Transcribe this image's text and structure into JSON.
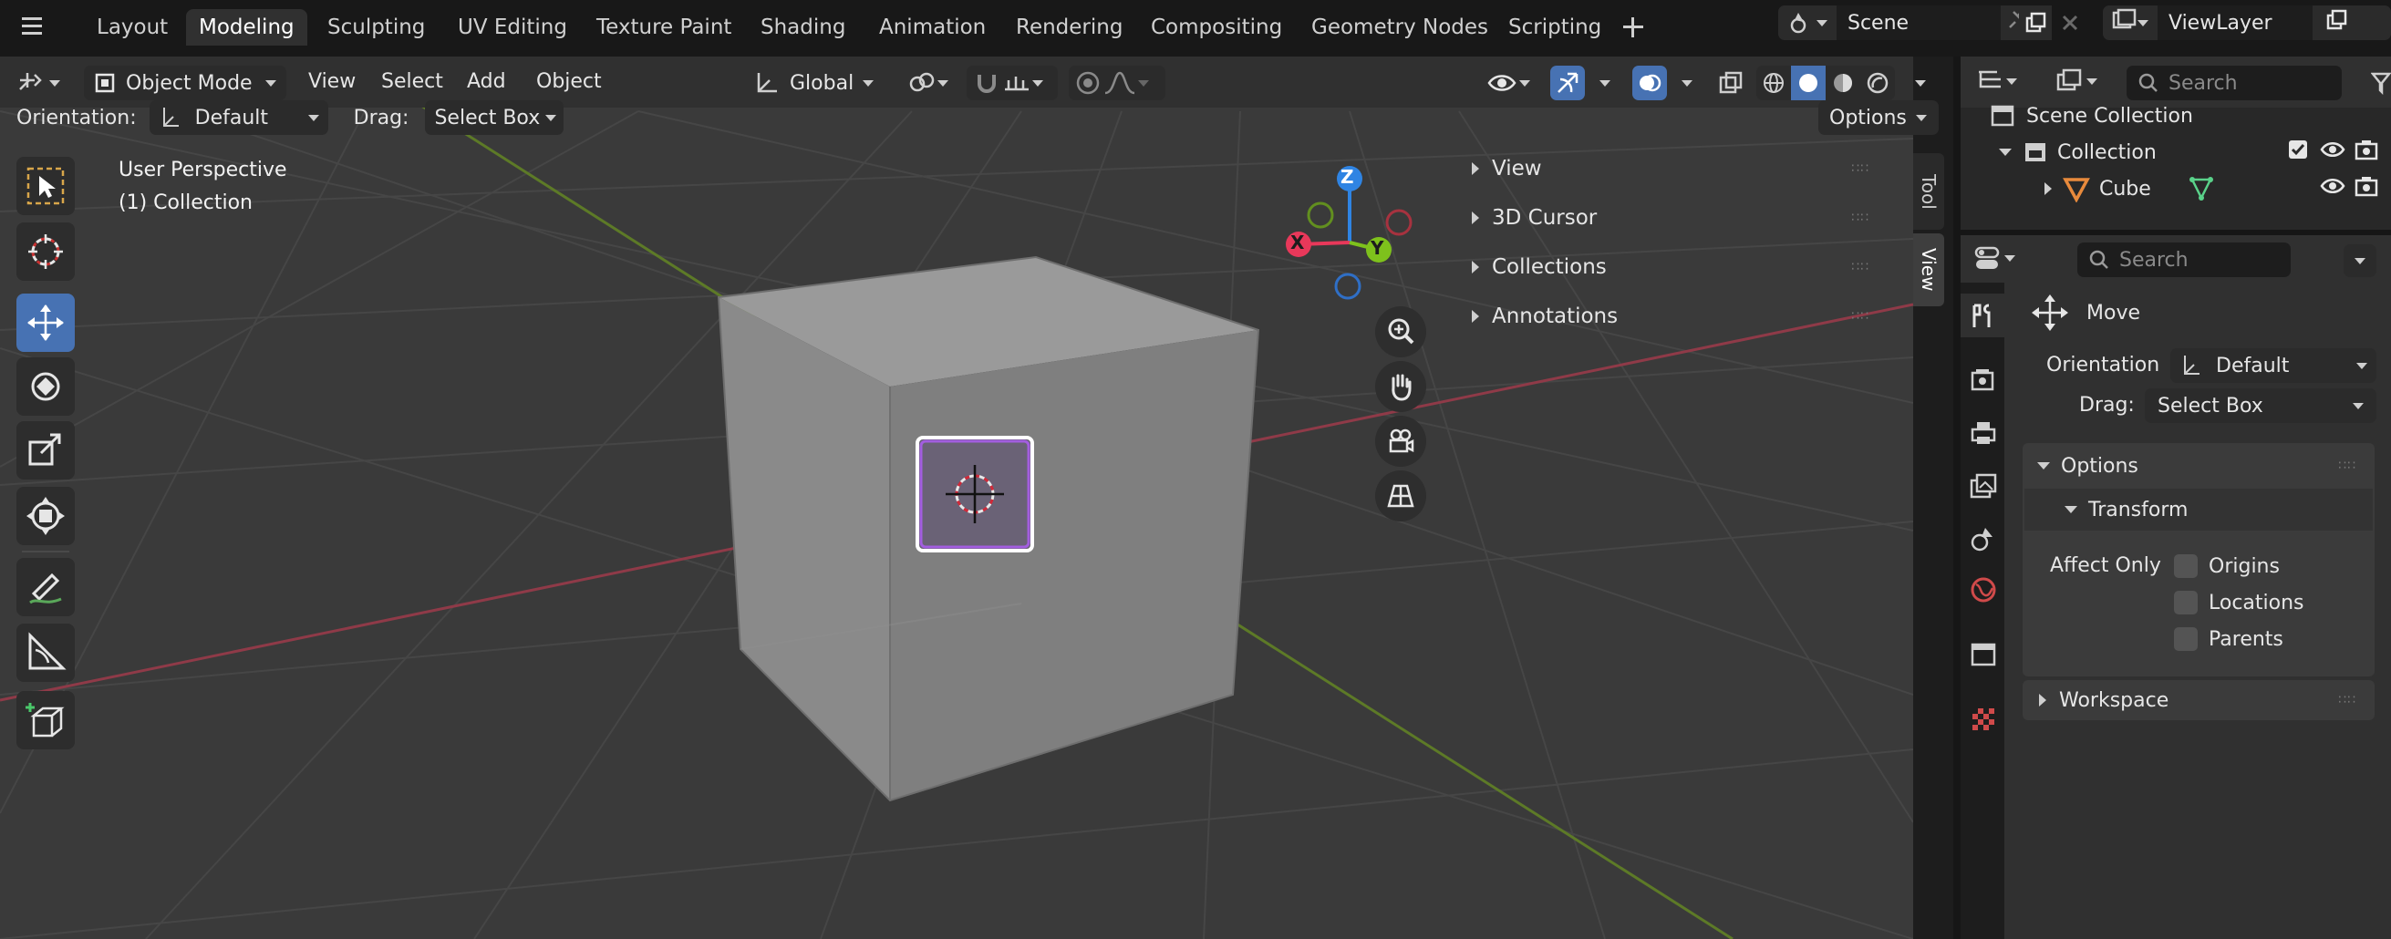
{
  "workspace_tabs": [
    "Layout",
    "Modeling",
    "Sculpting",
    "UV Editing",
    "Texture Paint",
    "Shading",
    "Animation",
    "Rendering",
    "Compositing",
    "Geometry Nodes",
    "Scripting"
  ],
  "active_workspace": "Modeling",
  "scene": {
    "name": "Scene"
  },
  "view_layer": {
    "name": "ViewLayer"
  },
  "viewport_header": {
    "mode": "Object Mode",
    "menus": [
      "View",
      "Select",
      "Add",
      "Object"
    ],
    "transform_orientation": "Global"
  },
  "tool_settings": {
    "orientation_label": "Orientation:",
    "orientation_value": "Default",
    "drag_label": "Drag:",
    "drag_value": "Select Box",
    "options_label": "Options"
  },
  "viewport_overlay_text": {
    "perspective": "User Perspective",
    "collection": "(1) Collection"
  },
  "gizmo_axes": {
    "x": "X",
    "y": "Y",
    "z": "Z"
  },
  "n_panel": {
    "items": [
      "View",
      "3D Cursor",
      "Collections",
      "Annotations"
    ],
    "tabs": [
      "Tool",
      "View"
    ]
  },
  "outliner": {
    "search_placeholder": "Search",
    "rows": [
      {
        "label": "Scene Collection"
      },
      {
        "label": "Collection"
      },
      {
        "label": "Cube"
      }
    ]
  },
  "properties": {
    "search_placeholder": "Search",
    "tool_name": "Move",
    "orientation_label": "Orientation",
    "orientation_value": "Default",
    "drag_label": "Drag:",
    "drag_value": "Select Box",
    "options_panel": "Options",
    "transform_panel": "Transform",
    "affect_only_label": "Affect Only",
    "affect_only_options": [
      "Origins",
      "Locations",
      "Parents"
    ],
    "workspace_panel": "Workspace"
  },
  "colors": {
    "accent_blue": "#4772b3",
    "axis_x": "#e8385a",
    "axis_y": "#7ec11c",
    "axis_z": "#2f84e3",
    "selection_outline": "#ffffff",
    "cube_face": "#7f7f7f"
  }
}
